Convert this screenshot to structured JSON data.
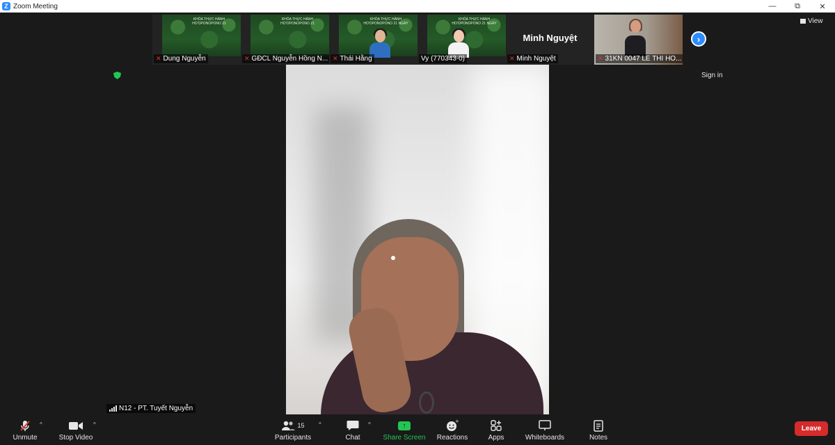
{
  "window": {
    "title": "Zoom Meeting",
    "logo": "Z",
    "minimize": "—",
    "maximize": "⧉",
    "close": "✕"
  },
  "top_right": {
    "view_label": "View",
    "sign_in": "Sign in"
  },
  "thumbnails": [
    {
      "name": "Dung Nguyễn",
      "banner": "KHÓA THỰC HÀNH\nHO'OPONOPONO 21",
      "type": "slide",
      "muted": true
    },
    {
      "name": "GĐCL Nguyễn Hồng N...",
      "banner": "KHÓA THỰC HÀNH\nHO'OPONOPONO 21",
      "type": "slide",
      "muted": true
    },
    {
      "name": "Thái Hằng",
      "banner": "KHÓA THỰC HÀNH\nHO'OPONOPONO 21 NGÀY",
      "type": "person",
      "muted": true
    },
    {
      "name": "Vy (770343-0)",
      "banner": "KHÓA THỰC HÀNH\nHO'OPONOPONO 21 NGÀY",
      "type": "person",
      "muted": false
    },
    {
      "name": "Minh Nguyệt",
      "big_name": "Minh Nguyệt",
      "type": "avatar",
      "muted": true
    },
    {
      "name": "31KN 0047 LE THI HO...",
      "type": "lady",
      "muted": true
    }
  ],
  "speaker": {
    "name": "N12 - PT. Tuyết Nguyễn"
  },
  "toolbar": {
    "unmute": "Unmute",
    "stop_video": "Stop Video",
    "participants": "Participants",
    "participants_count": "15",
    "chat": "Chat",
    "share_screen": "Share Screen",
    "reactions": "Reactions",
    "apps": "Apps",
    "whiteboards": "Whiteboards",
    "notes": "Notes",
    "leave": "Leave"
  },
  "colors": {
    "accent": "#2d8cff",
    "share": "#23c552",
    "leave": "#d52b2b",
    "muted": "#e0362c"
  }
}
